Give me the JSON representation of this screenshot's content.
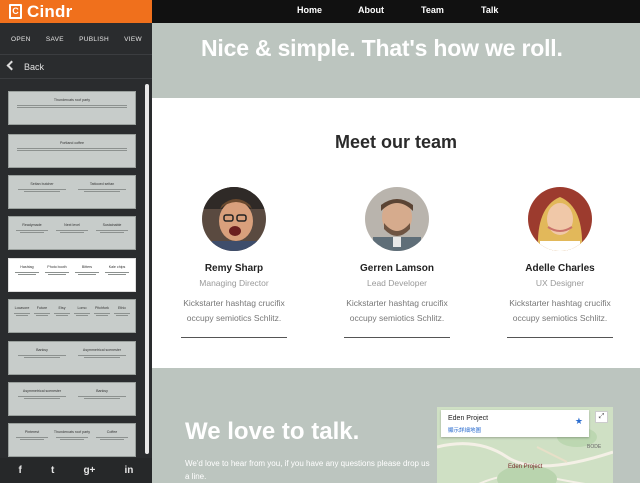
{
  "app": {
    "logo_letter": "C",
    "name": "Cindr",
    "collapse_icon": "chevron-left-icon"
  },
  "toolbar": {
    "open": "OPEN",
    "save": "SAVE",
    "publish": "PUBLISH",
    "view": "VIEW"
  },
  "sidebar": {
    "back_label": "Back",
    "thumbnails": [
      {
        "cols": [
          "Thundercats roof party"
        ],
        "wide": true
      },
      {
        "cols": [
          "Portland coffee"
        ],
        "wide": true
      },
      {
        "cols": [
          "Seitan butcher",
          "Tattooed seitan"
        ]
      },
      {
        "cols": [
          "Readymade",
          "Next level",
          "Sustainable"
        ]
      },
      {
        "cols": [
          "Hashtag",
          "Photo booth",
          "Bitters",
          "Kale chips"
        ],
        "active": true
      },
      {
        "cols": [
          "Locavore",
          "Future",
          "Etsy",
          "Lomo",
          "Pitchfork",
          "Ethic"
        ]
      },
      {
        "cols": [
          "Banksy",
          "Asymmetrical scenester"
        ]
      },
      {
        "cols": [
          "Asymmetrical scenester",
          "Banksy"
        ]
      },
      {
        "cols": [
          "Pinterest",
          "Thundercats roof party",
          "Coffee"
        ]
      }
    ],
    "social": [
      "f",
      "t",
      "g+",
      "in"
    ]
  },
  "nav": {
    "home": "Home",
    "about": "About",
    "team": "Team",
    "talk": "Talk"
  },
  "hero": {
    "headline": "Nice & simple. That's how we roll."
  },
  "team": {
    "heading": "Meet our team",
    "members": [
      {
        "name": "Remy Sharp",
        "role": "Managing Director",
        "bio_line1": "Kickstarter hashtag crucifix",
        "bio_line2": "occupy semiotics Schlitz."
      },
      {
        "name": "Gerren Lamson",
        "role": "Lead Developer",
        "bio_line1": "Kickstarter hashtag crucifix",
        "bio_line2": "occupy semiotics Schlitz."
      },
      {
        "name": "Adelle Charles",
        "role": "UX Designer",
        "bio_line1": "Kickstarter hashtag crucifix",
        "bio_line2": "occupy semiotics Schlitz."
      }
    ]
  },
  "contact": {
    "heading": "We love to talk.",
    "text": "We'd love to hear from you, if you have any questions please drop us a line.",
    "map": {
      "place": "Eden Project",
      "link": "顯示詳細地圖",
      "marker_label": "Eden Project",
      "road_label": "BODE"
    }
  },
  "colors": {
    "brand": "#f0701c",
    "sidebar": "#2a2c2e",
    "nav": "#111111",
    "sage": "#bcc5bf"
  }
}
